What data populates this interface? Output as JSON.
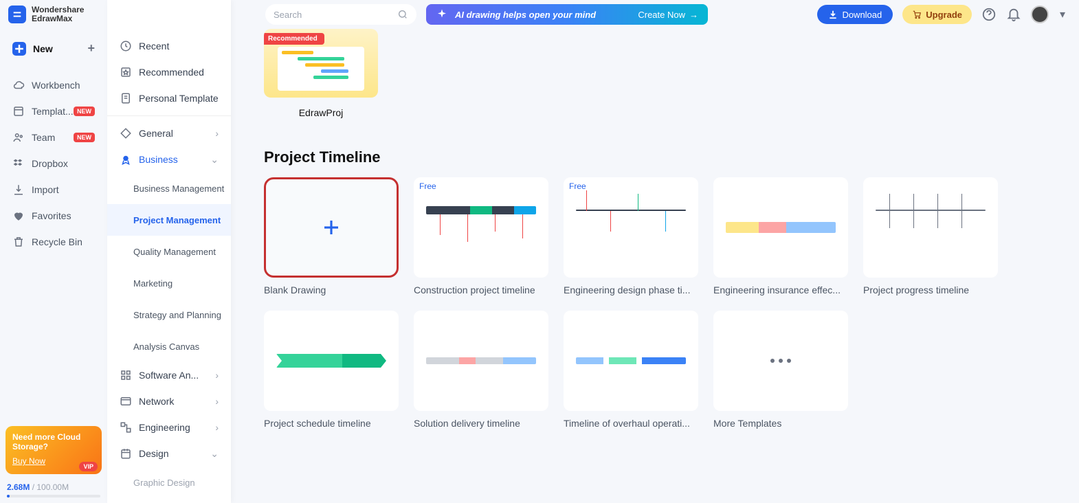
{
  "app": {
    "brand1": "Wondershare",
    "brand2": "EdrawMax"
  },
  "sidebar_main": {
    "new": "New",
    "items": [
      {
        "label": "Workbench"
      },
      {
        "label": "Templat...",
        "badge": "NEW"
      },
      {
        "label": "Team",
        "badge": "NEW"
      },
      {
        "label": "Dropbox"
      },
      {
        "label": "Import"
      },
      {
        "label": "Favorites"
      },
      {
        "label": "Recycle Bin"
      }
    ],
    "promo": {
      "title": "Need more Cloud Storage?",
      "buy": "Buy Now",
      "vip": "VIP"
    },
    "storage": {
      "used": "2.68M",
      "sep": " / ",
      "total": "100.00M"
    }
  },
  "sidebar_sec": {
    "top": [
      {
        "label": "Recent"
      },
      {
        "label": "Recommended"
      },
      {
        "label": "Personal Template"
      }
    ],
    "cats": [
      {
        "label": "General",
        "chev": "›"
      },
      {
        "label": "Business",
        "chev": "⌄",
        "active": true,
        "subs": [
          {
            "label": "Business Management"
          },
          {
            "label": "Project Management",
            "active": true
          },
          {
            "label": "Quality Management"
          },
          {
            "label": "Marketing"
          },
          {
            "label": "Strategy and Planning"
          },
          {
            "label": "Analysis Canvas"
          }
        ]
      },
      {
        "label": "Software An...",
        "chev": "›"
      },
      {
        "label": "Network",
        "chev": "›"
      },
      {
        "label": "Engineering",
        "chev": "›"
      },
      {
        "label": "Design",
        "chev": "⌄"
      },
      {
        "label": "Graphic Design"
      }
    ]
  },
  "topbar": {
    "search_ph": "Search",
    "ai_text": "AI drawing helps open your mind",
    "ai_cta": "Create Now",
    "download": "Download",
    "upgrade": "Upgrade"
  },
  "featured": {
    "ribbon": "Recommended",
    "label": "EdrawProj"
  },
  "section_title": "Project Timeline",
  "templates_row1": [
    {
      "label": "Blank Drawing",
      "blank": true
    },
    {
      "label": "Construction project timeline",
      "free": "Free"
    },
    {
      "label": "Engineering design phase ti...",
      "free": "Free"
    },
    {
      "label": "Engineering insurance effec..."
    },
    {
      "label": "Project progress timeline"
    }
  ],
  "templates_row2": [
    {
      "label": "Project schedule timeline"
    },
    {
      "label": "Solution delivery timeline"
    },
    {
      "label": "Timeline of overhaul operati..."
    },
    {
      "label": "More Templates",
      "more": true
    }
  ]
}
